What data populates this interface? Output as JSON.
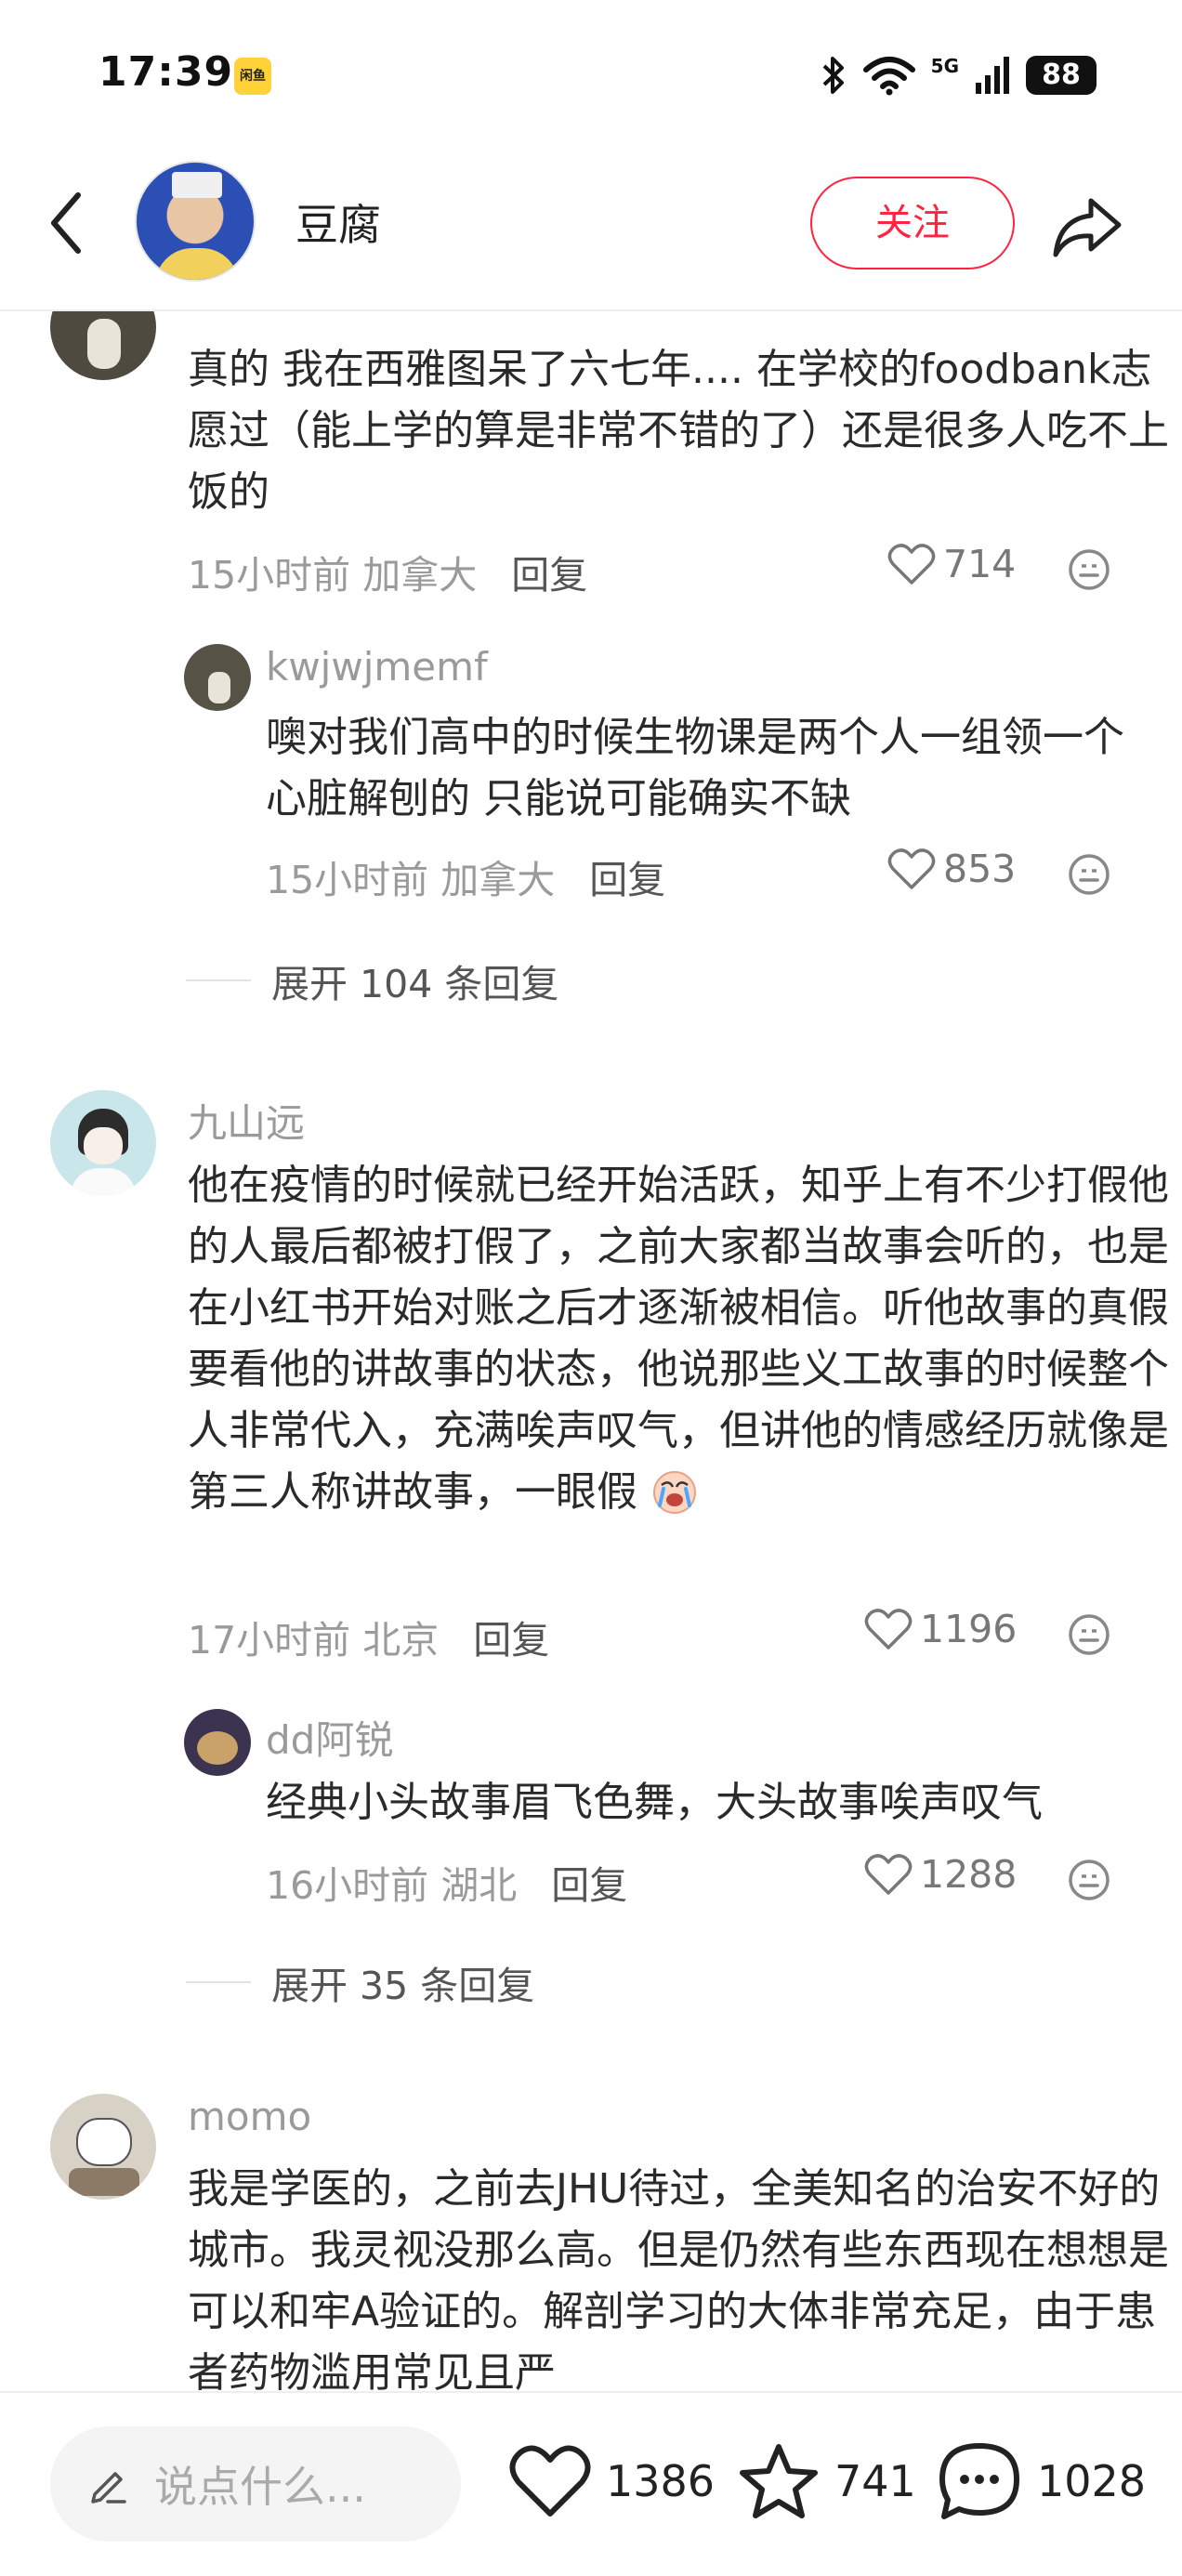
{
  "status_bar": {
    "time": "17:39",
    "app_badge": "闲鱼",
    "network": "5G",
    "battery": "88",
    "icons": [
      "bluetooth-icon",
      "wifi-icon",
      "signal-icon",
      "battery-icon"
    ]
  },
  "header": {
    "title": "豆腐",
    "follow_label": "关注",
    "icons": [
      "back-arrow-icon",
      "share-icon"
    ]
  },
  "comments": [
    {
      "id": "c1",
      "text": "真的 我在西雅图呆了六七年.... 在学校的foodbank志愿过（能上学的算是非常不错的了）还是很多人吃不上饭的",
      "time": "15小时前",
      "location": "加拿大",
      "reply_label": "回复",
      "likes": "714",
      "replies": [
        {
          "author": "kwjwjmemf",
          "text": "噢对我们高中的时候生物课是两个人一组领一个心脏解刨的 只能说可能确实不缺",
          "time": "15小时前",
          "location": "加拿大",
          "reply_label": "回复",
          "likes": "853"
        }
      ],
      "expand_label": "展开 104 条回复"
    },
    {
      "id": "c2",
      "author": "九山远",
      "text": "他在疫情的时候就已经开始活跃，知乎上有不少打假他的人最后都被打假了，之前大家都当故事会听的，也是在小红书开始对账之后才逐渐被相信。听他故事的真假要看他的讲故事的状态，他说那些义工故事的时候整个人非常代入，充满唉声叹气，但讲他的情感经历就像是第三人称讲故事，一眼假",
      "time": "17小时前",
      "location": "北京",
      "reply_label": "回复",
      "likes": "1196",
      "replies": [
        {
          "author": "dd阿锐",
          "text": "经典小头故事眉飞色舞，大头故事唉声叹气",
          "time": "16小时前",
          "location": "湖北",
          "reply_label": "回复",
          "likes": "1288"
        }
      ],
      "expand_label": "展开 35 条回复"
    },
    {
      "id": "c3",
      "author": "momo",
      "text": "我是学医的，之前去JHU待过，全美知名的治安不好的城市。我灵视没那么高。但是仍然有些东西现在想想是可以和牢A验证的。解剖学习的大体非常充足，由于患者药物滥用常见且严"
    }
  ],
  "bottom_bar": {
    "input_placeholder": "说点什么...",
    "likes": "1386",
    "favorites": "741",
    "comments": "1028"
  },
  "colors": {
    "accent": "#ff2442",
    "meta_text": "#9a9a9a"
  }
}
